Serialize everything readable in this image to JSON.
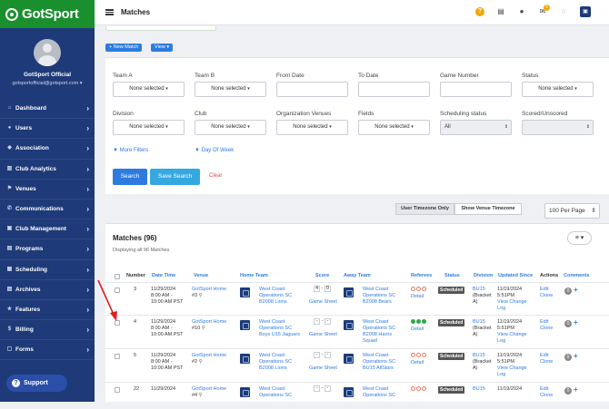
{
  "app": {
    "logo_text": "GotSport",
    "page_title": "Matches"
  },
  "user": {
    "name": "GotSport Official",
    "email": "gotsportofficial@gotsport.com"
  },
  "sidebar": {
    "items": [
      {
        "label": "Dashboard",
        "icon": "dashboard-icon"
      },
      {
        "label": "Users",
        "icon": "users-icon"
      },
      {
        "label": "Association",
        "icon": "association-icon"
      },
      {
        "label": "Club Analytics",
        "icon": "analytics-icon"
      },
      {
        "label": "Venues",
        "icon": "venues-icon"
      },
      {
        "label": "Communications",
        "icon": "communications-icon"
      },
      {
        "label": "Club Management",
        "icon": "club-management-icon"
      },
      {
        "label": "Programs",
        "icon": "programs-icon"
      },
      {
        "label": "Scheduling",
        "icon": "scheduling-icon"
      },
      {
        "label": "Archives",
        "icon": "archives-icon"
      },
      {
        "label": "Features",
        "icon": "features-icon"
      },
      {
        "label": "Billing",
        "icon": "billing-icon"
      },
      {
        "label": "Forms",
        "icon": "forms-icon"
      }
    ],
    "support_label": "Support"
  },
  "topbar": {
    "notifications_count": "9"
  },
  "actions": {
    "new_match": "+ New Match",
    "view": "View ▾"
  },
  "filters": {
    "team_a": {
      "label": "Team A",
      "value": "None selected"
    },
    "team_b": {
      "label": "Team B",
      "value": "None selected"
    },
    "from_date": {
      "label": "From Date"
    },
    "to_date": {
      "label": "To Date"
    },
    "game_number": {
      "label": "Game Number"
    },
    "status": {
      "label": "Status",
      "value": "None selected"
    },
    "division": {
      "label": "Division",
      "value": "None selected"
    },
    "club": {
      "label": "Club",
      "value": "None selected"
    },
    "org_venues": {
      "label": "Organization Venues",
      "value": "None selected"
    },
    "fields": {
      "label": "Fields",
      "value": "None selected"
    },
    "scheduling_status": {
      "label": "Scheduling status",
      "value": "All"
    },
    "scored": {
      "label": "Scored/Unscored"
    },
    "more_filters": "More Filters",
    "day_of_week": "Day Of Week",
    "search": "Search",
    "save_search": "Save Search",
    "clear": "Clear"
  },
  "timezone": {
    "user": "User Timezone Only",
    "venue": "Show Venue Timezone"
  },
  "per_page": "100 Per Page",
  "matches": {
    "title": "Matches (96)",
    "subtitle": "Displaying all 96 Matches",
    "columns": [
      "Number",
      "Date Time",
      "Venue",
      "Home Team",
      "Score",
      "Away Team",
      "Referees",
      "Status",
      "Division",
      "Updated Since",
      "Actions",
      "Comments"
    ],
    "rows": [
      {
        "number": "3",
        "date": "11/29/2024",
        "time1": "8:00 AM -",
        "time2": "10:00 AM PST",
        "venue1": "GotSport Home",
        "venue2": "#3",
        "home": [
          "West Coast",
          "Operations SC",
          "B2008 Lions"
        ],
        "score_home": "4",
        "score_away": "0",
        "game_sheet": "Game Sheet",
        "away": [
          "West Coast",
          "Operations SC",
          "B2008 Bears"
        ],
        "referees": "Detail",
        "status": "Scheduled",
        "division": [
          "BU15",
          "(Bracket",
          "A)"
        ],
        "updated": [
          "11/19/2024",
          "5:51PM"
        ],
        "view_change": [
          "View Change",
          "Log"
        ],
        "actions": [
          "Edit",
          "Clone"
        ]
      },
      {
        "number": "4",
        "date": "11/29/2024",
        "time1": "8:00 AM -",
        "time2": "10:00 AM PST",
        "venue1": "GotSport Home",
        "venue2": "#10",
        "home": [
          "West Coast",
          "Operations SC",
          "Boys U15 Jaguars"
        ],
        "score_home": "-",
        "score_away": "-",
        "game_sheet": "Game Sheet",
        "away": [
          "West Coast",
          "Operations SC",
          "B2008 Harris",
          "Squad"
        ],
        "referees": "Detail",
        "status": "Scheduled",
        "division": [
          "BU15",
          "(Bracket",
          "A)"
        ],
        "updated": [
          "11/19/2024",
          "5:51PM"
        ],
        "view_change": [
          "View Change",
          "Log"
        ],
        "actions": [
          "Edit",
          "Clone"
        ]
      },
      {
        "number": "5",
        "date": "11/29/2024",
        "time1": "8:00 AM -",
        "time2": "10:00 AM PST",
        "venue1": "GotSport Home",
        "venue2": "#2",
        "home": [
          "West Coast",
          "Operations SC",
          "B2008 Lions"
        ],
        "score_home": "-",
        "score_away": "-",
        "game_sheet": "Game Sheet",
        "away": [
          "West Coast",
          "Operations SC",
          "BU15 AllStars"
        ],
        "referees": "Detail",
        "status": "Scheduled",
        "division": [
          "BU15",
          "(Bracket",
          "A)"
        ],
        "updated": [
          "11/19/2024",
          "5:51PM"
        ],
        "view_change": [
          "View Change",
          "Log"
        ],
        "actions": [
          "Edit",
          "Clone"
        ]
      },
      {
        "number": "22",
        "date": "11/29/2024",
        "time1": "",
        "time2": "",
        "venue1": "GotSport Home",
        "venue2": "#4",
        "home": [
          "West Coast",
          "Operations SC"
        ],
        "score_home": "-",
        "score_away": "-",
        "game_sheet": "",
        "away": [
          "West Coast",
          "Operations SC"
        ],
        "referees": "",
        "status": "Scheduled",
        "division": [
          "BU15"
        ],
        "updated": [
          "11/19/2024"
        ],
        "view_change": [],
        "actions": [
          "Edit",
          "Clone"
        ]
      }
    ]
  },
  "colors": {
    "sidebar": "#1e3a78",
    "logo_bg": "#1a8f2d",
    "accent": "#2e7be0",
    "save_search": "#35a8e0",
    "clear": "#e04848",
    "annotation_arrow": "#e02020"
  }
}
